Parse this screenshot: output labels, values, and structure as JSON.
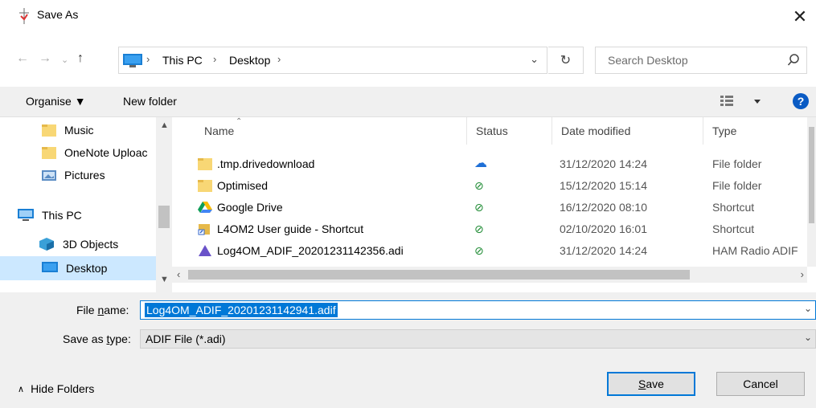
{
  "window": {
    "title": "Save As"
  },
  "address_bar": {
    "crumbs": [
      "This PC",
      "Desktop"
    ],
    "search_placeholder": "Search Desktop"
  },
  "toolbar": {
    "organise_label": "Organise ▼",
    "new_folder_label": "New folder"
  },
  "nav_pane": {
    "items": [
      {
        "label": "Music",
        "icon": "folder-icon"
      },
      {
        "label": "OneNote Uploac",
        "icon": "folder-icon"
      },
      {
        "label": "Pictures",
        "icon": "pictures-icon"
      },
      {
        "label": "This PC",
        "icon": "pc-icon"
      },
      {
        "label": "3D Objects",
        "icon": "3d-objects-icon"
      },
      {
        "label": "Desktop",
        "icon": "desktop-icon",
        "selected": true
      }
    ]
  },
  "file_list": {
    "columns": [
      "Name",
      "Status",
      "Date modified",
      "Type"
    ],
    "rows": [
      {
        "name": ".tmp.drivedownload",
        "status": "cloud",
        "date": "31/12/2020 14:24",
        "type": "File folder",
        "icon": "folder-icon"
      },
      {
        "name": "Optimised",
        "status": "synced",
        "date": "15/12/2020 15:14",
        "type": "File folder",
        "icon": "folder-icon"
      },
      {
        "name": "Google Drive",
        "status": "synced",
        "date": "16/12/2020 08:10",
        "type": "Shortcut",
        "icon": "google-drive-icon"
      },
      {
        "name": "L4OM2 User guide - Shortcut",
        "status": "synced",
        "date": "02/10/2020 16:01",
        "type": "Shortcut",
        "icon": "shortcut-icon"
      },
      {
        "name": "Log4OM_ADIF_20201231142356.adi",
        "status": "synced",
        "date": "31/12/2020 14:24",
        "type": "HAM Radio ADIF",
        "icon": "adif-file-icon"
      }
    ]
  },
  "form": {
    "filename_label_pre": "File ",
    "filename_label_key": "n",
    "filename_label_post": "ame:",
    "filename_value": "Log4OM_ADIF_20201231142941.adif",
    "savetype_label_pre": "Save as ",
    "savetype_label_key": "t",
    "savetype_label_post": "ype:",
    "savetype_value": "ADIF File (*.adi)"
  },
  "footer": {
    "hide_folders_label": "Hide Folders",
    "save_label_key": "S",
    "save_label_rest": "ave",
    "cancel_label": "Cancel"
  },
  "colors": {
    "accent": "#0078d7",
    "selection": "#cce8ff",
    "synced": "#1e8b33",
    "cloud": "#1f6fd6"
  }
}
